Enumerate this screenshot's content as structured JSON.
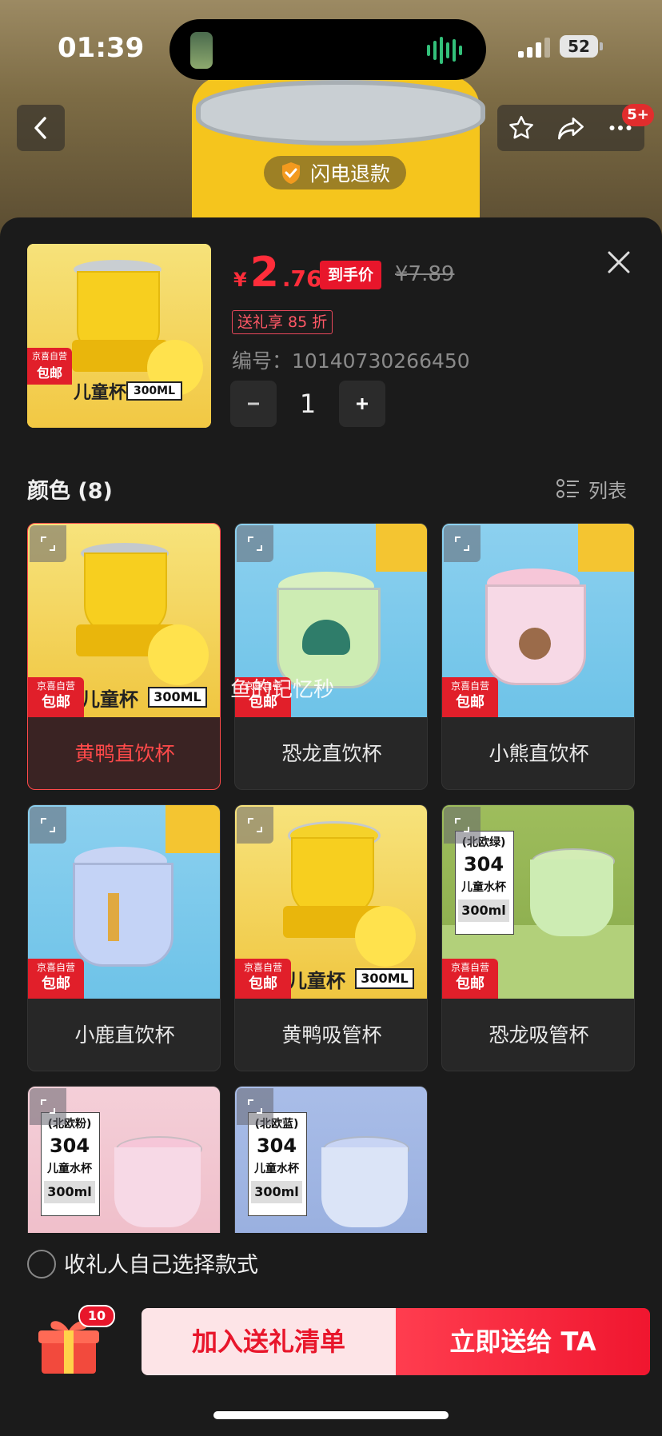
{
  "status_bar": {
    "time": "01:39",
    "battery": "52"
  },
  "nav": {
    "cart_badge": "5+",
    "refund_label": "闪电退款"
  },
  "product": {
    "currency": "¥",
    "price_int": "2",
    "price_dec": ".76",
    "hand_price_tag": "到手价",
    "original_price": "¥7.89",
    "discount_tag": "送礼享 85 折",
    "sku_label": "编号：",
    "sku": "10140730266450",
    "quantity": "1",
    "main_img_caption": "儿童杯",
    "main_img_size": "300ML"
  },
  "badge": {
    "jd_top": "京喜自营",
    "jd_bottom": "包邮"
  },
  "section": {
    "color_title": "颜色 (8)",
    "list_label": "列表"
  },
  "variants": [
    {
      "name": "黄鸭直饮杯",
      "selected": true
    },
    {
      "name": "恐龙直饮杯",
      "selected": false
    },
    {
      "name": "小熊直饮杯",
      "selected": false
    },
    {
      "name": "小鹿直饮杯",
      "selected": false
    },
    {
      "name": "黄鸭吸管杯",
      "selected": false
    },
    {
      "name": "恐龙吸管杯",
      "selected": false
    },
    {
      "name": "",
      "selected": false
    },
    {
      "name": "",
      "selected": false
    }
  ],
  "card_tags": {
    "duck_caption": "儿童杯",
    "duck_size": "300ML",
    "green_tag": [
      "(北欧绿)",
      "304",
      "儿童水杯",
      "300ml"
    ],
    "pink_tag": [
      "(北欧粉)",
      "304",
      "儿童水杯",
      "300ml"
    ],
    "blue_tag": [
      "(北欧蓝)",
      "304",
      "儿童水杯",
      "300ml"
    ]
  },
  "watermark": "鱼的记忆秒",
  "footer": {
    "self_choose": "收礼人自己选择款式",
    "gift_badge": "10",
    "add_button": "加入送礼清单",
    "send_button": "立即送给 TA"
  },
  "colors": {
    "accent": "#e8162b",
    "bg": "#1b1b1b"
  }
}
